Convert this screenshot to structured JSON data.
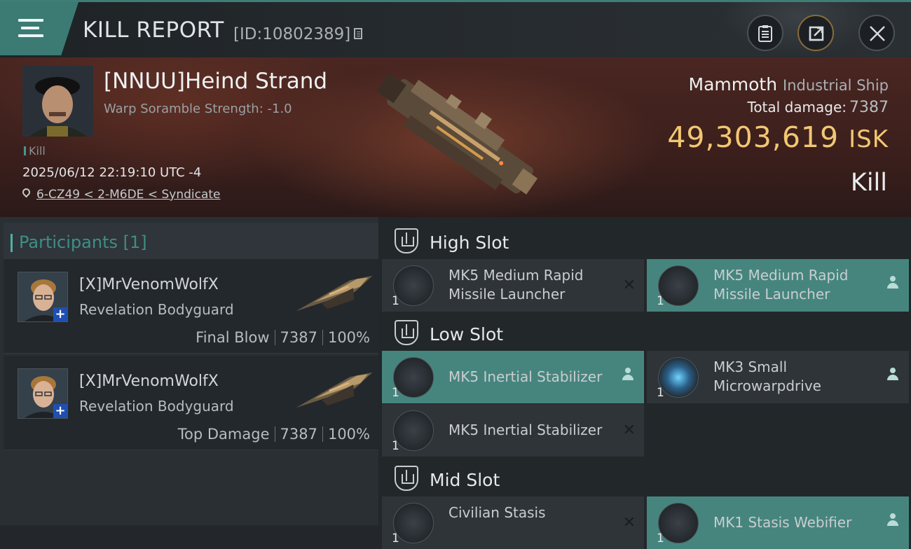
{
  "header": {
    "title": "KILL REPORT",
    "report_id": "[ID:10802389]"
  },
  "victim": {
    "name": "[NNUU]Heind Strand",
    "warp_scramble": "Warp Soramble Strength: -1.0",
    "kill_tag": "Kill",
    "datetime": "2025/06/12 22:19:10 UTC -4",
    "location": "6-CZ49 < 2-M6DE < Syndicate",
    "ship_name": "Mammoth",
    "ship_class": "Industrial Ship",
    "total_damage_label": "Total damage:",
    "total_damage_value": "7387",
    "isk_value": "49,303,619",
    "isk_unit": "ISK",
    "result": "Kill"
  },
  "participants": {
    "label": "Participants [1]",
    "items": [
      {
        "name": "[X]MrVenomWolfX",
        "ship": "Revelation Bodyguard",
        "role": "Final Blow",
        "damage": "7387",
        "percent": "100%",
        "badge": "+"
      },
      {
        "name": "[X]MrVenomWolfX",
        "ship": "Revelation Bodyguard",
        "role": "Top Damage",
        "damage": "7387",
        "percent": "100%",
        "badge": "+"
      }
    ]
  },
  "slots": {
    "high": {
      "label": "High Slot",
      "modules": [
        {
          "name": "MK5 Medium Rapid Missile Launcher",
          "qty": "1",
          "status": "destroyed"
        },
        {
          "name": "MK5 Medium Rapid Missile Launcher",
          "qty": "1",
          "status": "dropped"
        }
      ]
    },
    "low": {
      "label": "Low Slot",
      "modules": [
        {
          "name": "MK5 Inertial Stabilizer",
          "qty": "1",
          "status": "dropped"
        },
        {
          "name": "MK3 Small Microwarpdrive",
          "qty": "1",
          "status": "dropped"
        },
        {
          "name": "MK5 Inertial Stabilizer",
          "qty": "1",
          "status": "destroyed"
        }
      ]
    },
    "mid": {
      "label": "Mid Slot",
      "modules": [
        {
          "name": "Civilian Stasis",
          "qty": "1",
          "status": "destroyed"
        },
        {
          "name": "MK1 Stasis Webifier",
          "qty": "1",
          "status": "dropped"
        }
      ]
    }
  },
  "colors": {
    "accent": "#46857e",
    "isk": "#f2c772",
    "badge": "#1f4fb3"
  },
  "icons": [
    "menu-icon",
    "copy-icon",
    "clipboard-icon",
    "share-icon",
    "close-icon",
    "location-pin-icon",
    "shield-slot-icon",
    "user-icon",
    "x-icon"
  ]
}
